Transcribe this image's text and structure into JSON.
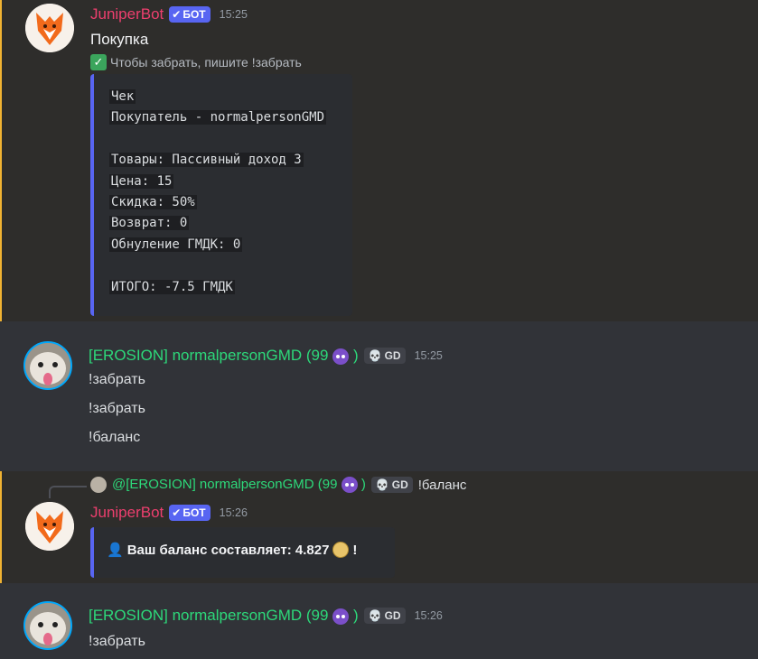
{
  "messages": {
    "m1": {
      "author": "JuniperBot",
      "bot_tag": "БОТ",
      "time": "15:25",
      "title": "Покупка",
      "subtitle": "Чтобы забрать, пишите !забрать",
      "receipt": [
        "Чек",
        "Покупатель - normalpersonGMD",
        "",
        "Товары: Пассивный доход 3",
        "Цена: 15",
        "Скидка: 50%",
        "Возврат: 0",
        "Обнуление ГМДК: 0",
        "",
        "ИТОГО: -7.5 ГМДК"
      ]
    },
    "m2": {
      "author": "[EROSION] normalpersonGMD (99",
      "author_suffix": ")",
      "gd_tag": "GD",
      "time": "15:25",
      "lines": [
        "!забрать",
        "!забрать",
        "!баланс"
      ]
    },
    "m3": {
      "reply_author": "@[EROSION] normalpersonGMD (99",
      "reply_author_suffix": ")",
      "reply_gd_tag": "GD",
      "reply_text": "!баланс",
      "author": "JuniperBot",
      "bot_tag": "БОТ",
      "time": "15:26",
      "embed_text": "Ваш баланс составляет: 4.827",
      "embed_suffix": "!"
    },
    "m4": {
      "author": "[EROSION] normalpersonGMD (99",
      "author_suffix": ")",
      "gd_tag": "GD",
      "time": "15:26",
      "lines": [
        "!забрать"
      ]
    }
  },
  "colors": {
    "background": "#313338",
    "bot_name": "#ed3f6e",
    "user_name": "#2dd97a",
    "embed_accent": "#5865f2",
    "highlight_border": "#f0b232"
  },
  "icons": [
    "fox-avatar",
    "cat-avatar",
    "checkmark-icon",
    "devil-emoji",
    "skull-icon",
    "user-icon",
    "coin-icon"
  ]
}
